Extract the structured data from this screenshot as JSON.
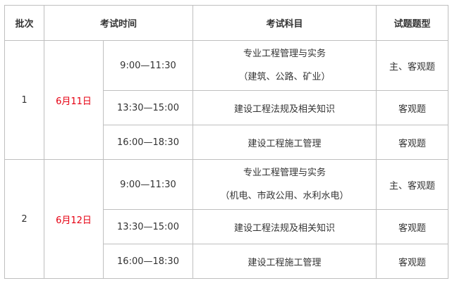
{
  "table": {
    "headers": {
      "batch": "批次",
      "time": "考试时间",
      "subject": "考试科目",
      "question_type": "试题题型"
    },
    "batches": [
      {
        "batch": "1",
        "date": "6月11日",
        "sessions": [
          {
            "time": "9:00—11:30",
            "subject_lines": [
              "专业工程管理与实务",
              "（建筑、公路、矿业）"
            ],
            "type": "主、客观题"
          },
          {
            "time": "13:30—15:00",
            "subject_lines": [
              "建设工程法规及相关知识"
            ],
            "type": "客观题"
          },
          {
            "time": "16:00—18:30",
            "subject_lines": [
              "建设工程施工管理"
            ],
            "type": "客观题"
          }
        ]
      },
      {
        "batch": "2",
        "date": "6月12日",
        "sessions": [
          {
            "time": "9:00—11:30",
            "subject_lines": [
              "专业工程管理与实务",
              "（机电、市政公用、水利水电）"
            ],
            "type": "主、客观题"
          },
          {
            "time": "13:30—15:00",
            "subject_lines": [
              "建设工程法规及相关知识"
            ],
            "type": "客观题"
          },
          {
            "time": "16:00—18:30",
            "subject_lines": [
              "建设工程施工管理"
            ],
            "type": "客观题"
          }
        ]
      }
    ],
    "colors": {
      "border": "#bfbfbf",
      "text": "#333333",
      "date": "#e60012"
    }
  }
}
